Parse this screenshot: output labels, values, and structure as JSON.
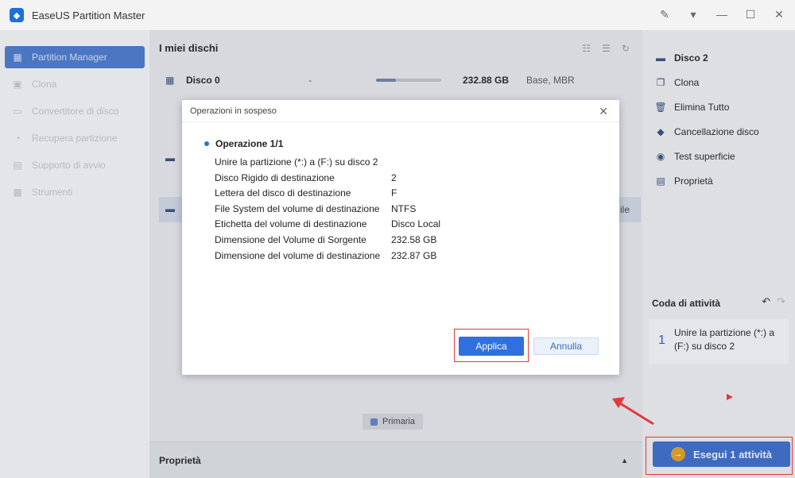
{
  "app": {
    "title": "EaseUS Partition Master"
  },
  "colors": {
    "accent": "#2f6fe0",
    "highlight": "#e03a3a",
    "exec_bg": "#3e6bbf"
  },
  "sidebar": {
    "items": [
      {
        "label": "Partition Manager",
        "icon": "partition-icon",
        "active": true
      },
      {
        "label": "Clona",
        "icon": "clone-icon"
      },
      {
        "label": "Convertitore di disco",
        "icon": "convert-icon"
      },
      {
        "label": "Recupera partizione",
        "icon": "recover-icon"
      },
      {
        "label": "Supporto di avvio",
        "icon": "boot-media-icon"
      },
      {
        "label": "Strumenti",
        "icon": "tools-icon"
      }
    ]
  },
  "main": {
    "header": "I miei dischi",
    "disks": [
      {
        "name": "Disco 0",
        "dash": "-",
        "size": "232.88 GB",
        "type": "Base, MBR"
      }
    ],
    "selected_row_fragment": "ile",
    "legend": "Primaria",
    "properties": "Proprietà"
  },
  "right_panel": {
    "disk": "Disco 2",
    "actions": [
      "Clona",
      "Elimina Tutto",
      "Cancellazione disco",
      "Test superficie",
      "Proprietà"
    ],
    "queue_title": "Coda di attività",
    "queue_item": {
      "num": "1",
      "text": "Unire la partizione (*:) a (F:) su disco 2"
    },
    "execute": "Esegui 1 attività"
  },
  "modal": {
    "title": "Operazioni in sospeso",
    "op_title": "Operazione 1/1",
    "op_desc": "Unire la partizione (*:) a (F:) su disco 2",
    "rows": [
      {
        "k": "Disco Rigido di destinazione",
        "v": "2"
      },
      {
        "k": "Lettera del disco di destinazione",
        "v": "F"
      },
      {
        "k": "File System del volume di destinazione",
        "v": "NTFS"
      },
      {
        "k": "Etichetta del volume di destinazione",
        "v": "Disco Local"
      },
      {
        "k": "Dimensione del Volume di Sorgente",
        "v": "232.58 GB"
      },
      {
        "k": "Dimensione del volume di destinazione",
        "v": "232.87 GB"
      }
    ],
    "apply": "Applica",
    "cancel": "Annulla"
  }
}
